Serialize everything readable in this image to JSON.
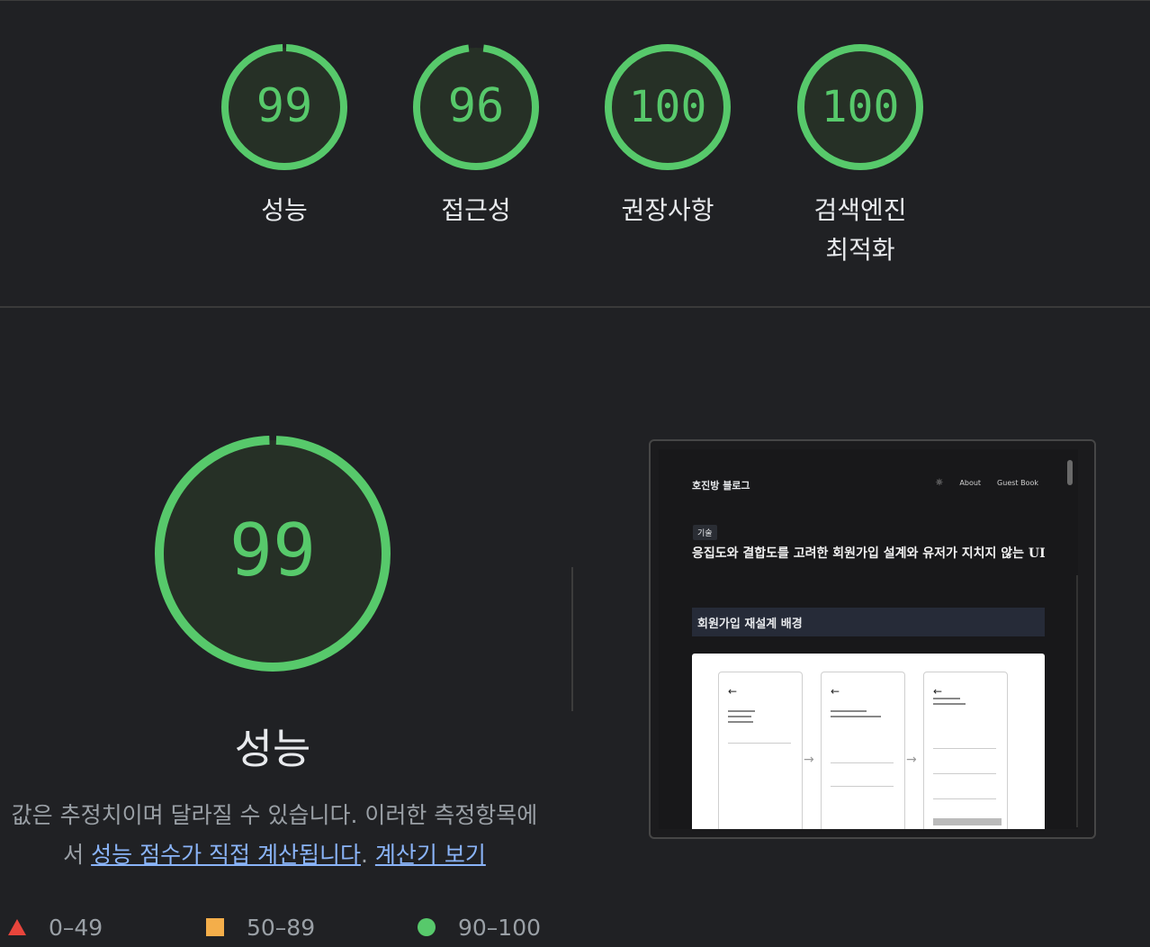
{
  "gauges": [
    {
      "score": "99",
      "value": 99,
      "label_lines": [
        "성능"
      ]
    },
    {
      "score": "96",
      "value": 96,
      "label_lines": [
        "접근성"
      ]
    },
    {
      "score": "100",
      "value": 100,
      "label_lines": [
        "권장사항"
      ]
    },
    {
      "score": "100",
      "value": 100,
      "label_lines": [
        "검색엔진",
        "최적화"
      ]
    }
  ],
  "performance": {
    "score": "99",
    "value": 99,
    "title": "성능",
    "desc_prefix": "값은 추정치이며 달라질 수 있습니다. 이러한 측정항목에서 ",
    "desc_link1": "성능 점수가 직접 계산됩니다",
    "desc_mid": ". ",
    "desc_link2": "계산기 보기"
  },
  "legend": [
    {
      "range": "0–49",
      "icon": "triangle-icon",
      "color": "#e8453c"
    },
    {
      "range": "50–89",
      "icon": "square-icon",
      "color": "#f4ae4a"
    },
    {
      "range": "90–100",
      "icon": "circle-icon",
      "color": "#57c96b"
    }
  ],
  "colors": {
    "pass": "#57c96b",
    "pass_fill": "#263026",
    "background": "#202124",
    "link": "#8ab4f8"
  },
  "screenshot": {
    "site_title": "호진방 블로그",
    "nav_about": "About",
    "nav_guestbook": "Guest Book",
    "tag": "기술",
    "post_title": "응집도와 결합도를 고려한 회원가입 설계와 유저가 지치지 않는 UI",
    "section_heading": "회원가입 재설계 배경"
  }
}
